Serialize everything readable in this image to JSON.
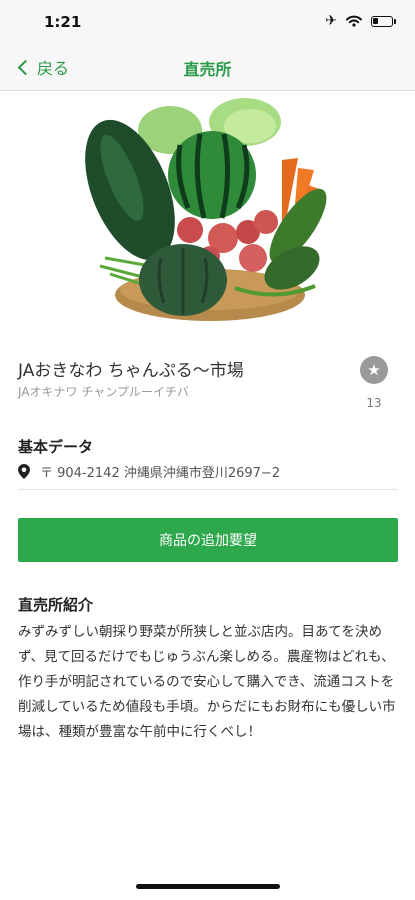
{
  "status_bar": {
    "time": "1:21",
    "battery_level": 0.3
  },
  "nav": {
    "back_label": "戻る",
    "title": "直売所"
  },
  "store": {
    "name": "JAおきなわ ちゃんぷる～市場",
    "kana": "JAオキナワ チャンプルーイチバ",
    "favorite_count": "13"
  },
  "basic_data": {
    "heading": "基本データ",
    "address": "〒 904-2142 沖縄県沖縄市登川2697−2"
  },
  "actions": {
    "request_button": "商品の追加要望"
  },
  "intro": {
    "heading": "直売所紹介",
    "text": "みずみずしい朝採り野菜が所狭しと並ぶ店内。目あてを決めず、見て回るだけでもじゅうぶん楽しめる。農産物はどれも、作り手が明記されているので安心して購入でき、流通コストを削減しているため値段も手頃。からだにもお財布にも優しい市場は、種類が豊富な午前中に行くべし！"
  },
  "colors": {
    "accent": "#2b9b4a",
    "button": "#2ea84d",
    "favorite": "#9a9a9a"
  },
  "icons": [
    "airplane-icon",
    "wifi-icon",
    "battery-icon",
    "chevron-left-icon",
    "star-icon",
    "location-pin-icon"
  ]
}
